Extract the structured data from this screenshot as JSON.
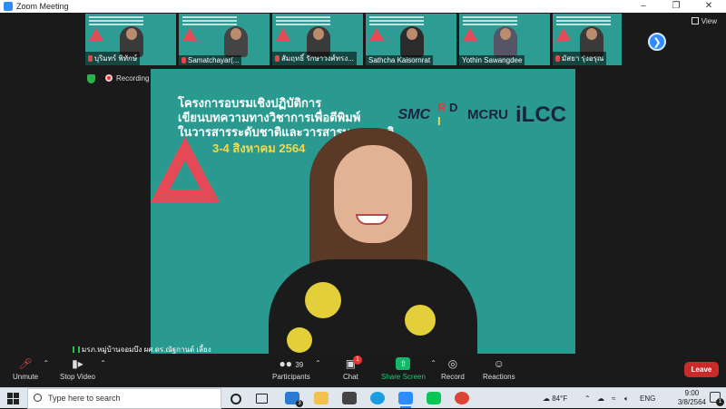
{
  "window": {
    "title": "Zoom Meeting"
  },
  "gallery": {
    "participants": [
      {
        "name": "บุริมทร์ พิทักษ์",
        "muted": true
      },
      {
        "name": "Samatchayar(...",
        "muted": true
      },
      {
        "name": "สัมฤทธิ์ รักษาวงศ์ทรง...",
        "muted": true
      },
      {
        "name": "Sathcha Kaisornrat",
        "muted": false
      },
      {
        "name": "Yothin Sawangdee",
        "muted": false
      },
      {
        "name": "มัสยา รุ่งอรุณ",
        "muted": true
      }
    ],
    "next_icon": "chevron-right-icon",
    "view_label": "View"
  },
  "status": {
    "recording_label": "Recording"
  },
  "main": {
    "banner_lines": [
      "โครงการอบรมเชิงปฏิบัติการ",
      "เขียนบทความทางวิชาการเพื่อตีพิมพ์",
      "ในวารสารระดับชาติและวารสารนานาชาติ"
    ],
    "banner_date": "3-4 สิงหาคม 2564",
    "logo_smc": "SMC",
    "logo_rd": [
      "R",
      "D",
      "I",
      ""
    ],
    "logo_mcru": "MCRU",
    "logo_ilcc": "iLCC",
    "speaker_name": "มรภ.หมู่บ้านจอมบึง ผศ.ดร.ณัฐกานต์ เลี้ยง"
  },
  "toolbar": {
    "unmute": "Unmute",
    "stop_video": "Stop Video",
    "participants": "Participants",
    "participants_count": "39",
    "chat": "Chat",
    "chat_badge": "1",
    "share_screen": "Share Screen",
    "record": "Record",
    "reactions": "Reactions",
    "leave": "Leave"
  },
  "taskbar": {
    "search_placeholder": "Type here to search",
    "mail_badge": "3",
    "weather": "84°F",
    "language": "ENG",
    "time": "9:00",
    "date": "3/8/2564",
    "notification_count": "1"
  },
  "colors": {
    "zoom_blue": "#2d8cff",
    "slide_teal": "#2a9a90",
    "leave_red": "#c92a2a",
    "share_green": "#12b76a"
  }
}
